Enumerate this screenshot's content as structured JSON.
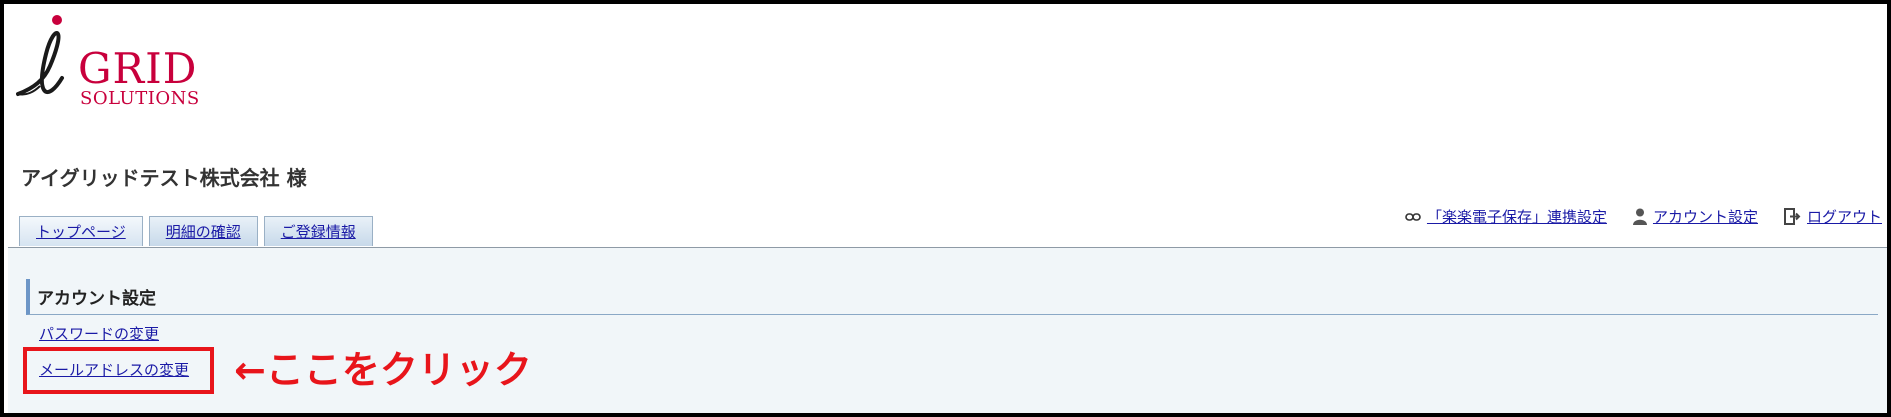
{
  "logo": {
    "main_text": "GRID",
    "sub_text": "SOLUTIONS",
    "brand_color": "#c8003c"
  },
  "company_name": "アイグリッドテスト株式会社 様",
  "tabs": [
    {
      "label": "トップページ"
    },
    {
      "label": "明細の確認"
    },
    {
      "label": "ご登録情報"
    }
  ],
  "top_links": {
    "rakuraku": {
      "label": "「楽楽電子保存」連携設定",
      "icon": "link-icon"
    },
    "account": {
      "label": "アカウント設定",
      "icon": "user-icon"
    },
    "logout": {
      "label": "ログアウト",
      "icon": "logout-icon"
    }
  },
  "section": {
    "title": "アカウント設定",
    "links": {
      "password": "パスワードの変更",
      "email": "メールアドレスの変更"
    }
  },
  "annotation": {
    "text": "←ここをクリック",
    "color": "#e8151b"
  },
  "colors": {
    "link": "#1a1aa6",
    "content_bg": "#f1f6f9",
    "section_accent": "#6d96c7"
  }
}
